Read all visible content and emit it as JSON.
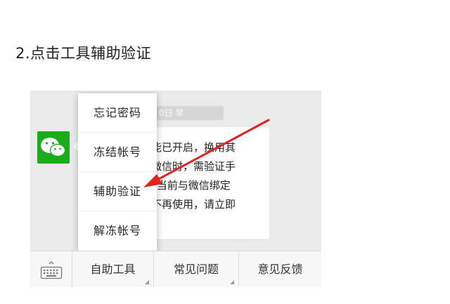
{
  "heading": "2.点击工具辅助验证",
  "chat": {
    "timestamp_fragment": "0日 早",
    "message_lines": [
      "能已开启，换用其",
      "微信时，需验证手",
      "“当前与微信绑定",
      "不再使用，请立即"
    ]
  },
  "menu": {
    "items": [
      {
        "label": "忘记密码"
      },
      {
        "label": "冻结帐号"
      },
      {
        "label": "辅助验证"
      },
      {
        "label": "解冻帐号"
      }
    ]
  },
  "bottom_bar": {
    "tabs": [
      {
        "label": "自助工具"
      },
      {
        "label": "常见问题"
      },
      {
        "label": "意见反馈"
      }
    ]
  },
  "colors": {
    "accent_green": "#1aad19",
    "arrow_red": "#e32222"
  },
  "icons": [
    "wechat-logo-icon",
    "keyboard-icon",
    "red-arrow-annotation"
  ]
}
